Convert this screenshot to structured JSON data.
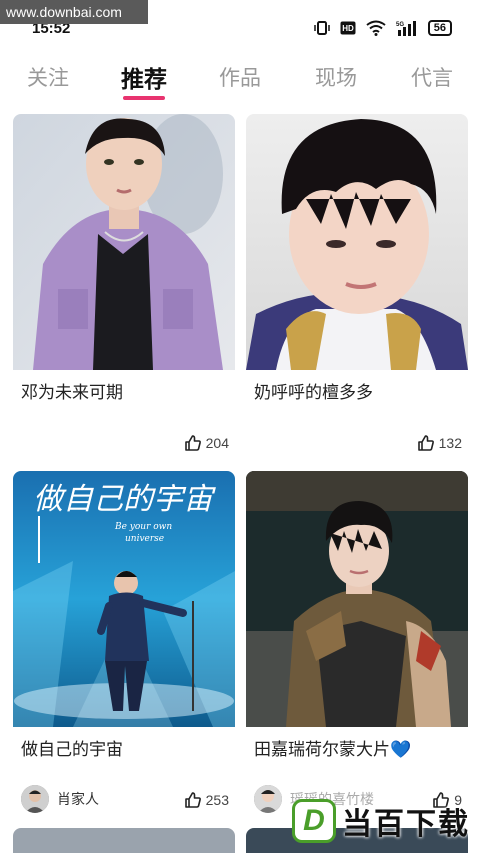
{
  "watermark": "www.downbai.com",
  "status": {
    "time": "15:52",
    "battery": "56",
    "network": "5G"
  },
  "tabs": [
    {
      "label": "关注",
      "active": false
    },
    {
      "label": "推荐",
      "active": true
    },
    {
      "label": "作品",
      "active": false
    },
    {
      "label": "现场",
      "active": false
    },
    {
      "label": "代言",
      "active": false
    }
  ],
  "cards": [
    {
      "title": "邓为未来可期",
      "likes": "204",
      "author": ""
    },
    {
      "title": "奶呼呼的檀多多",
      "likes": "132",
      "author": ""
    },
    {
      "title": "做自己的宇宙",
      "likes": "253",
      "author": "肖家人"
    },
    {
      "title": "田嘉瑞荷尔蒙大片💙",
      "likes": "9",
      "author": "瑶瑶的喜竹楼"
    }
  ],
  "poster_text": {
    "main": "做自己的宇宙",
    "sub1": "Be your own",
    "sub2": "universe"
  },
  "logo": {
    "letter": "D",
    "text": "当百下载"
  },
  "colors": {
    "accent": "#e8336f",
    "logo_green": "#4a9e2a"
  }
}
